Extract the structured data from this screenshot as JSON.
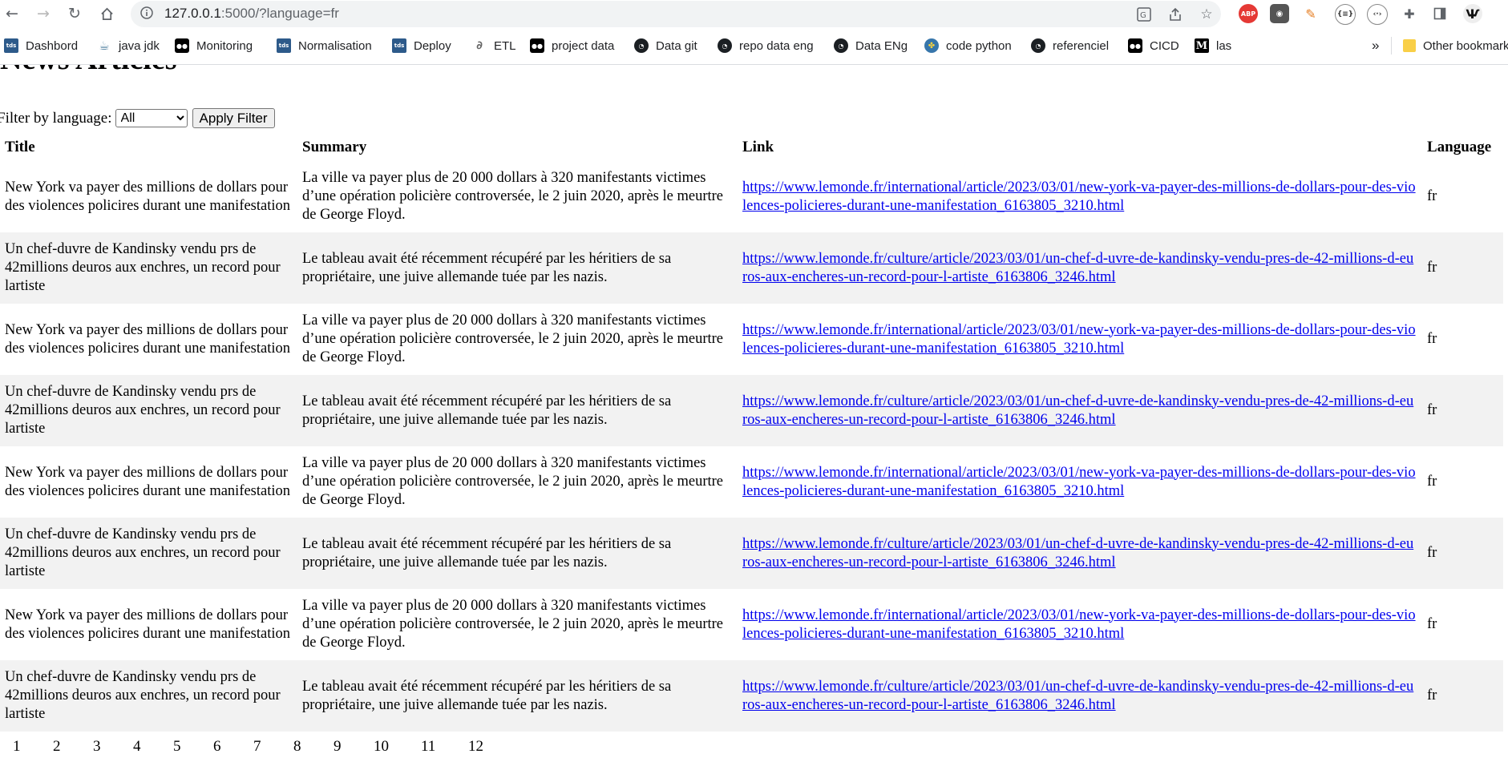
{
  "browser": {
    "url_host": "127.0.0.1",
    "url_path": ":5000/?language=fr",
    "bookmarks": [
      {
        "label": "Dashbord",
        "icon": "tds"
      },
      {
        "label": "java jdk",
        "icon": "java"
      },
      {
        "label": "Monitoring",
        "icon": "monitor"
      },
      {
        "label": "Normalisation",
        "icon": "tds"
      },
      {
        "label": "Deploy",
        "icon": "tds"
      },
      {
        "label": "ETL",
        "icon": "etl"
      },
      {
        "label": "project data",
        "icon": "monitor"
      },
      {
        "label": "Data git",
        "icon": "github"
      },
      {
        "label": "repo data eng",
        "icon": "github"
      },
      {
        "label": "Data ENg",
        "icon": "github"
      },
      {
        "label": "code python",
        "icon": "python"
      },
      {
        "label": "referenciel",
        "icon": "github"
      },
      {
        "label": "CICD",
        "icon": "monitor"
      },
      {
        "label": "las",
        "icon": "medium"
      }
    ],
    "overflow_label": "»",
    "other_bookmarks_label": "Other bookmarks"
  },
  "page": {
    "title": "News Articles",
    "filter_label": "Filter by language:",
    "filter_selected": "All",
    "apply_label": "Apply Filter"
  },
  "table": {
    "headers": [
      "Title",
      "Summary",
      "Link",
      "Language"
    ],
    "rows": [
      {
        "title": "New York va payer des millions de dollars pour des violences policires durant une manifestation",
        "summary": "La ville va payer plus de 20 000 dollars à 320 manifestants victimes d’une opération policière controversée, le 2 juin 2020, après le meurtre de George Floyd.",
        "link": "https://www.lemonde.fr/international/article/2023/03/01/new-york-va-payer-des-millions-de-dollars-pour-des-violences-policieres-durant-une-manifestation_6163805_3210.html",
        "language": "fr"
      },
      {
        "title": "Un chef-duvre de Kandinsky vendu prs de 42millions deuros aux enchres, un record pour lartiste",
        "summary": "Le tableau avait été récemment récupéré par les héritiers de sa propriétaire, une juive allemande tuée par les nazis.",
        "link": "https://www.lemonde.fr/culture/article/2023/03/01/un-chef-d-uvre-de-kandinsky-vendu-pres-de-42-millions-d-euros-aux-encheres-un-record-pour-l-artiste_6163806_3246.html",
        "language": "fr"
      },
      {
        "title": "New York va payer des millions de dollars pour des violences policires durant une manifestation",
        "summary": "La ville va payer plus de 20 000 dollars à 320 manifestants victimes d’une opération policière controversée, le 2 juin 2020, après le meurtre de George Floyd.",
        "link": "https://www.lemonde.fr/international/article/2023/03/01/new-york-va-payer-des-millions-de-dollars-pour-des-violences-policieres-durant-une-manifestation_6163805_3210.html",
        "language": "fr"
      },
      {
        "title": "Un chef-duvre de Kandinsky vendu prs de 42millions deuros aux enchres, un record pour lartiste",
        "summary": "Le tableau avait été récemment récupéré par les héritiers de sa propriétaire, une juive allemande tuée par les nazis.",
        "link": "https://www.lemonde.fr/culture/article/2023/03/01/un-chef-d-uvre-de-kandinsky-vendu-pres-de-42-millions-d-euros-aux-encheres-un-record-pour-l-artiste_6163806_3246.html",
        "language": "fr"
      },
      {
        "title": "New York va payer des millions de dollars pour des violences policires durant une manifestation",
        "summary": "La ville va payer plus de 20 000 dollars à 320 manifestants victimes d’une opération policière controversée, le 2 juin 2020, après le meurtre de George Floyd.",
        "link": "https://www.lemonde.fr/international/article/2023/03/01/new-york-va-payer-des-millions-de-dollars-pour-des-violences-policieres-durant-une-manifestation_6163805_3210.html",
        "language": "fr"
      },
      {
        "title": "Un chef-duvre de Kandinsky vendu prs de 42millions deuros aux enchres, un record pour lartiste",
        "summary": "Le tableau avait été récemment récupéré par les héritiers de sa propriétaire, une juive allemande tuée par les nazis.",
        "link": "https://www.lemonde.fr/culture/article/2023/03/01/un-chef-d-uvre-de-kandinsky-vendu-pres-de-42-millions-d-euros-aux-encheres-un-record-pour-l-artiste_6163806_3246.html",
        "language": "fr"
      },
      {
        "title": "New York va payer des millions de dollars pour des violences policires durant une manifestation",
        "summary": "La ville va payer plus de 20 000 dollars à 320 manifestants victimes d’une opération policière controversée, le 2 juin 2020, après le meurtre de George Floyd.",
        "link": "https://www.lemonde.fr/international/article/2023/03/01/new-york-va-payer-des-millions-de-dollars-pour-des-violences-policieres-durant-une-manifestation_6163805_3210.html",
        "language": "fr"
      },
      {
        "title": "Un chef-duvre de Kandinsky vendu prs de 42millions deuros aux enchres, un record pour lartiste",
        "summary": "Le tableau avait été récemment récupéré par les héritiers de sa propriétaire, une juive allemande tuée par les nazis.",
        "link": "https://www.lemonde.fr/culture/article/2023/03/01/un-chef-d-uvre-de-kandinsky-vendu-pres-de-42-millions-d-euros-aux-encheres-un-record-pour-l-artiste_6163806_3246.html",
        "language": "fr"
      }
    ]
  },
  "pagination": [
    "1",
    "2",
    "3",
    "4",
    "5",
    "6",
    "7",
    "8",
    "9",
    "10",
    "11",
    "12"
  ]
}
